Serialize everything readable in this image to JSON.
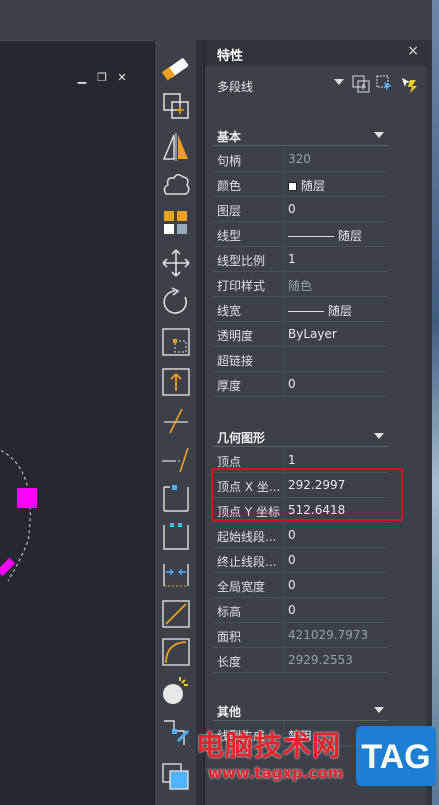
{
  "panel": {
    "title": "特性",
    "close": "×",
    "object_type": "多段线"
  },
  "sections": {
    "basic": "基本",
    "geometry": "几何图形",
    "other": "其他"
  },
  "basic_rows": [
    {
      "key": "句柄",
      "value": "320",
      "dim": true
    },
    {
      "key": "颜色",
      "value": "随层",
      "dim": false
    },
    {
      "key": "图层",
      "value": "0",
      "dim": false
    },
    {
      "key": "线型",
      "value": "随层",
      "dim": false
    },
    {
      "key": "线型比例",
      "value": "1",
      "dim": false
    },
    {
      "key": "打印样式",
      "value": "随色",
      "dim": true
    },
    {
      "key": "线宽",
      "value": "随层",
      "dim": false
    },
    {
      "key": "透明度",
      "value": "ByLayer",
      "dim": false
    },
    {
      "key": "超链接",
      "value": "",
      "dim": false
    },
    {
      "key": "厚度",
      "value": "0",
      "dim": false
    }
  ],
  "geometry_rows": [
    {
      "key": "顶点",
      "value": "1",
      "dim": false
    },
    {
      "key": "顶点 X 坐...",
      "value": "292.2997",
      "dim": false
    },
    {
      "key": "顶点 Y 坐标",
      "value": "512.6418",
      "dim": false
    },
    {
      "key": "起始线段...",
      "value": "0",
      "dim": false
    },
    {
      "key": "终止线段...",
      "value": "0",
      "dim": false
    },
    {
      "key": "全局宽度",
      "value": "0",
      "dim": false
    },
    {
      "key": "标高",
      "value": "0",
      "dim": false
    },
    {
      "key": "面积",
      "value": "421029.7973",
      "dim": true
    },
    {
      "key": "长度",
      "value": "2929.2553",
      "dim": true
    }
  ],
  "other_rows": [
    {
      "key": "线型生成",
      "value": "禁用",
      "dim": false
    }
  ],
  "watermark": {
    "brand": "电脑技术网",
    "url": "www.tagxp.com",
    "logo": "TAG"
  },
  "colors": {
    "highlight": "#d8141b",
    "magenta": "#ff00ff",
    "accent_orange": "#f0a020"
  }
}
